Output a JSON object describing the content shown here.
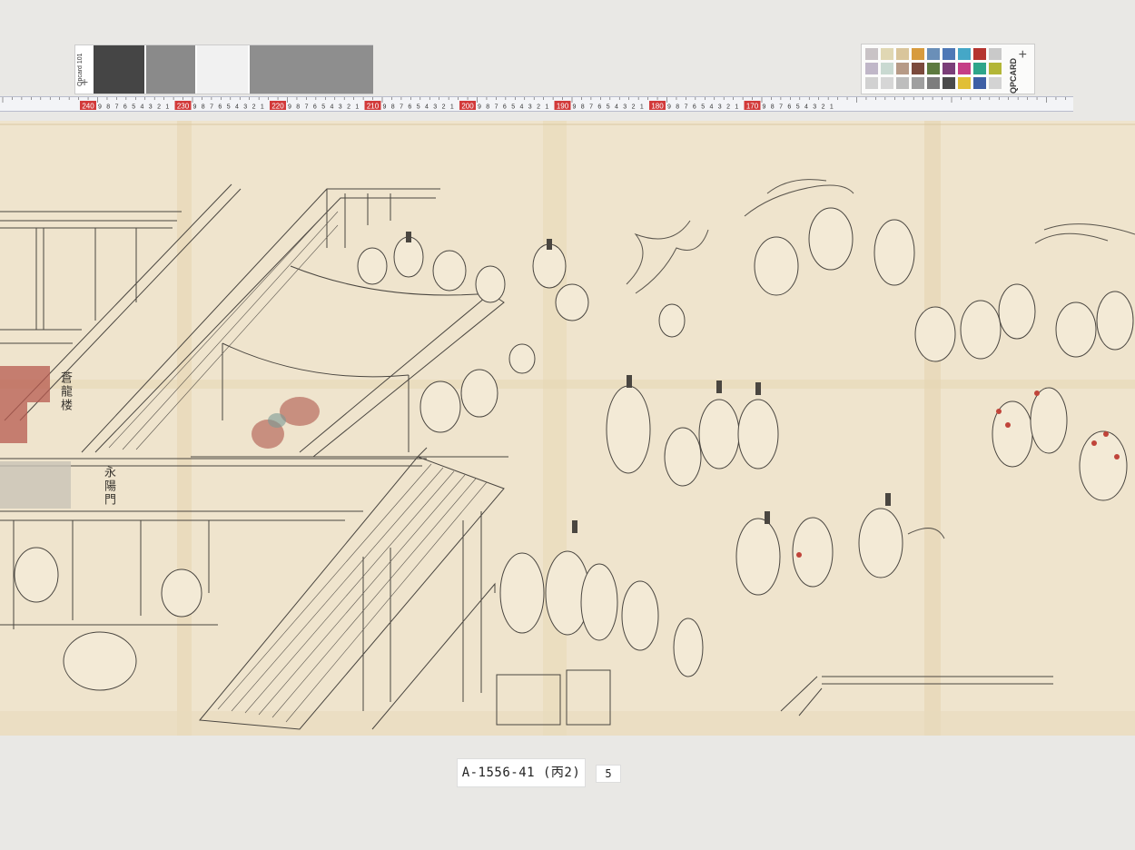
{
  "gray_card": {
    "brand": "Qpcard 101",
    "swatches": [
      {
        "name": "black",
        "color": "#454545"
      },
      {
        "name": "mid-gray",
        "color": "#8a8a8a"
      },
      {
        "name": "white",
        "color": "#f1f1f1"
      },
      {
        "name": "gray",
        "color": "#8e8e8e"
      }
    ]
  },
  "color_card": {
    "brand": "QPCARD",
    "swatches": [
      "#c9c3c6",
      "#e0d7b3",
      "#d9c59b",
      "#d79b3e",
      "#6a8fb8",
      "#4e78b6",
      "#45a7c7",
      "#b5342f",
      "#c9c9c9",
      "#c0b7c8",
      "#c9d9d1",
      "#b69a86",
      "#7b4a3c",
      "#5d7a3f",
      "#7a3e78",
      "#c53e86",
      "#2ea58a",
      "#b3b637",
      "#d1d1d1",
      "#d6d6d6",
      "#bdbdbd",
      "#9f9f9f",
      "#7d7d7d",
      "#4b4b4b",
      "#e1bf35",
      "#3e5fa5",
      "#d3d3d3"
    ]
  },
  "ruler": {
    "labels": [
      "240",
      "230",
      "220",
      "210",
      "200",
      "190",
      "180",
      "170"
    ],
    "accent": "#d23a3a"
  },
  "artwork": {
    "captions": [
      "蒼龍楼",
      "永陽門"
    ],
    "paper_color": "#efe4cd",
    "ink_color": "#4a4640"
  },
  "labels": {
    "catalog_id": "A-1556-41 (丙2)",
    "frame_number": "5"
  }
}
